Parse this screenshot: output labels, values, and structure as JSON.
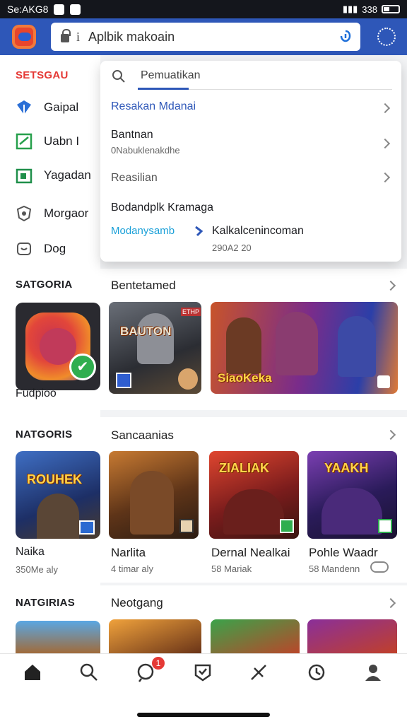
{
  "status_bar": {
    "left_text": "Se:AKG8",
    "right_text": "338"
  },
  "address_bar": {
    "url_text": "Aplbik makoain",
    "info_glyph": "i"
  },
  "sidebar": {
    "heading_top": "SETSGAU",
    "items": [
      {
        "label": "Gaipal",
        "icon": "diamond-icon"
      },
      {
        "label": "Uabn I",
        "icon": "check-square-icon"
      },
      {
        "label": "Yagadan",
        "icon": "gallery-icon"
      },
      {
        "label": "Morgaor",
        "icon": "shield-icon"
      },
      {
        "label": "Dog",
        "icon": "tray-icon"
      }
    ],
    "heading_2": "SATGORIA",
    "featured_app": {
      "name": "Fudpioo"
    },
    "heading_3": "NATGORIS",
    "app_2": {
      "name": "Naika",
      "sub": "350Me aly"
    },
    "heading_4": "NATGIRIAS"
  },
  "dropdown": {
    "query": "Pemuatikan",
    "rows": [
      {
        "title": "Resakan Mdanai"
      },
      {
        "title": "Bantnan",
        "sub": "0Nabuklenakdhe"
      },
      {
        "title": "Reasilian"
      }
    ],
    "section_title": "Bodandplk Kramaga",
    "link_left": "Modanysamb",
    "link_right": "Kalkalcenincoman",
    "link_right_sub": "290A2 20"
  },
  "sections": {
    "s1": {
      "title": "Bentetamed",
      "game1_overlay": "BAUTON",
      "game1_tag": "ETHP",
      "game2_overlay": "SiaoKeka"
    },
    "s2": {
      "title": "Sancaanias",
      "cards": [
        {
          "name": "Narlita",
          "sub": "4 timar aly",
          "overlay": ""
        },
        {
          "name": "Dernal Nealkai",
          "sub": "58 Mariak",
          "overlay": "ZIALIAK"
        },
        {
          "name": "Pohle Waadr",
          "sub": "58 Mandenn",
          "overlay": "YAAKH"
        }
      ],
      "side_overlay": "ROUHEK"
    },
    "s3": {
      "title": "Neotgang"
    }
  },
  "bottom_nav": {
    "badge_count": "1"
  },
  "colors": {
    "accent": "#2e57b8",
    "badge": "#e53935",
    "link": "#1aa0d8"
  }
}
